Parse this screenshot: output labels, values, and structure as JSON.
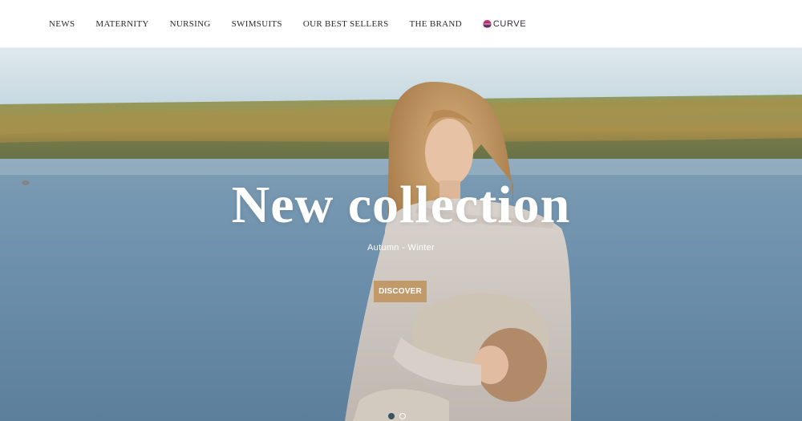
{
  "nav": {
    "items": [
      {
        "label": "NEWS"
      },
      {
        "label": "MATERNITY"
      },
      {
        "label": "NURSING"
      },
      {
        "label": "SWIMSUITS"
      },
      {
        "label": "OUR BEST SELLERS"
      },
      {
        "label": "THE BRAND"
      }
    ],
    "curve_label": "CURVE",
    "curve_icon": "curve-logo-icon"
  },
  "hero": {
    "title": "New collection",
    "subtitle": "Autumn - Winter",
    "button_label": "DISCOVER",
    "slide_count": 2,
    "active_slide": 1
  },
  "colors": {
    "button": "#c29a6a",
    "nav_text": "#2b2b2b",
    "dot_active": "#3a5360"
  }
}
